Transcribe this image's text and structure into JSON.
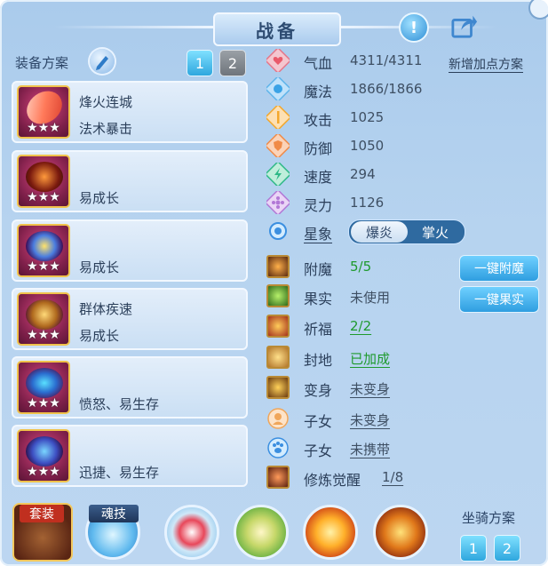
{
  "title": "战备",
  "equip_scheme": {
    "label": "装备方案",
    "schemes": [
      "1",
      "2"
    ]
  },
  "equipment": [
    {
      "name": "烽火连城",
      "effect": "法术暴击",
      "stars": "★★★"
    },
    {
      "name": "",
      "effect": "易成长",
      "stars": "★★★"
    },
    {
      "name": "",
      "effect": "易成长",
      "stars": "★★★"
    },
    {
      "name": "群体疾速",
      "effect": "易成长",
      "stars": "★★★"
    },
    {
      "name": "",
      "effect": "愤怒、易生存",
      "stars": "★★★"
    },
    {
      "name": "",
      "effect": "迅捷、易生存",
      "stars": "★★★"
    }
  ],
  "stats": [
    {
      "label": "气血",
      "value": "4311/4311",
      "icon": "heart-icon",
      "color": "#e95a6b"
    },
    {
      "label": "魔法",
      "value": "1866/1866",
      "icon": "mana-icon",
      "color": "#3aa3e6"
    },
    {
      "label": "攻击",
      "value": "1025",
      "icon": "sword-icon",
      "color": "#f4a72b"
    },
    {
      "label": "防御",
      "value": "1050",
      "icon": "shield-icon",
      "color": "#f08b48"
    },
    {
      "label": "速度",
      "value": "294",
      "icon": "lightning-icon",
      "color": "#2fb987"
    },
    {
      "label": "灵力",
      "value": "1126",
      "icon": "spirit-icon",
      "color": "#b278d6"
    }
  ],
  "add_point_link": "新增加点方案",
  "star_sign": {
    "label": "星象",
    "options": [
      "爆炎",
      "掌火"
    ],
    "selected": "爆炎"
  },
  "extras": [
    {
      "label": "附魔",
      "value": "5/5",
      "style": "green",
      "icon": "enchant-icon"
    },
    {
      "label": "果实",
      "value": "未使用",
      "style": "plain",
      "icon": "fruit-icon"
    },
    {
      "label": "祈福",
      "value": "2/2",
      "style": "green-link",
      "icon": "blessing-icon"
    },
    {
      "label": "封地",
      "value": "已加成",
      "style": "green-link",
      "icon": "fief-icon"
    },
    {
      "label": "变身",
      "value": "未变身",
      "style": "link",
      "icon": "transform-icon"
    },
    {
      "label": "子女",
      "value": "未变身",
      "style": "link",
      "icon": "child-icon"
    },
    {
      "label": "子女",
      "value": "未携带",
      "style": "link",
      "icon": "paw-icon"
    },
    {
      "label": "修炼觉醒",
      "value": "1/8",
      "style": "link",
      "icon": "cultivation-icon"
    }
  ],
  "buttons": {
    "enchant": "一键附魔",
    "fruit": "一键果实"
  },
  "bottom": {
    "suit_label": "套装",
    "soul_label": "魂技",
    "mount_label": "坐骑方案",
    "mount_schemes": [
      "1",
      "2"
    ]
  },
  "colors": {
    "panel": "#b6d3ef",
    "accent": "#2fa7de",
    "green": "#1e9a2d"
  }
}
